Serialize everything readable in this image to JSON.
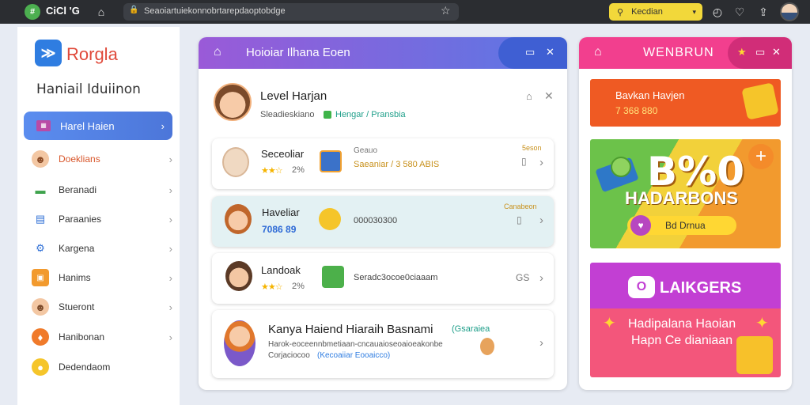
{
  "browser": {
    "logo": "#",
    "brand": "CiCl 'G",
    "url": "Seaoiartuiekonnobrtarepdaoptobdge",
    "search_label": "Kecdian"
  },
  "sidebar": {
    "logo_text": "Rorgla",
    "subtitle": "Haniail Iduiinon",
    "active_item": "Harel Haien",
    "items": [
      {
        "label": "Doeklians",
        "icon": "avatar-icon",
        "color": "#d8562b"
      },
      {
        "label": "Beranadi",
        "icon": "wallet-icon",
        "color": "#333"
      },
      {
        "label": "Paraanies",
        "icon": "chart-icon",
        "color": "#333"
      },
      {
        "label": "Kargena",
        "icon": "gear-icon",
        "color": "#333"
      },
      {
        "label": "Hanims",
        "icon": "grid-icon",
        "color": "#333"
      },
      {
        "label": "Stueront",
        "icon": "avatar-icon",
        "color": "#333"
      },
      {
        "label": "Hanibonan",
        "icon": "shield-icon",
        "color": "#333"
      },
      {
        "label": "Dedendaom",
        "icon": "coin-icon",
        "color": "#333"
      }
    ]
  },
  "center": {
    "title": "Hoioiar Ilhana Eoen",
    "profile_name": "Level Harjan",
    "profile_sub": "Sleadieskiano",
    "profile_sub_link": "Hengar / Pransbia",
    "cards": [
      {
        "title": "Seceoliar",
        "rating": "2%",
        "stars": "★★☆",
        "info_top": "Geauo",
        "info": "Saeaniar / 3 580 ABIS",
        "tag": "5eson"
      },
      {
        "title": "Haveliar",
        "rating": "7086 89",
        "info": "000030300",
        "tag": "Canabeon"
      },
      {
        "title": "Landoak",
        "rating": "2%",
        "stars": "★★☆",
        "info": "Seradc3ocoe0ciaaam",
        "side": "GS"
      }
    ],
    "big_card": {
      "title": "Kanya Haiend Hiaraih Basnami",
      "title_link": "(Gsaraiea",
      "line1": "Harok-eoceennbmetiaan-cncauaioseoaioeakonbe",
      "line2": "Corjaciocoo",
      "line2_link": "(Kecoaiiar Eooaicco)"
    }
  },
  "right": {
    "title": "WENBRUN",
    "promo1_title": "Bavkan Havjen",
    "promo1_sub": "7 368 880",
    "promo2_big": "B%0",
    "promo2_sub": "HADARBONS",
    "promo2_btn": "Bd  Drnua",
    "promo3_title": "LAIKGERS",
    "promo3_l1": "Hadipalana Haoian",
    "promo3_l2": "Hapn Ce dianiaan"
  }
}
